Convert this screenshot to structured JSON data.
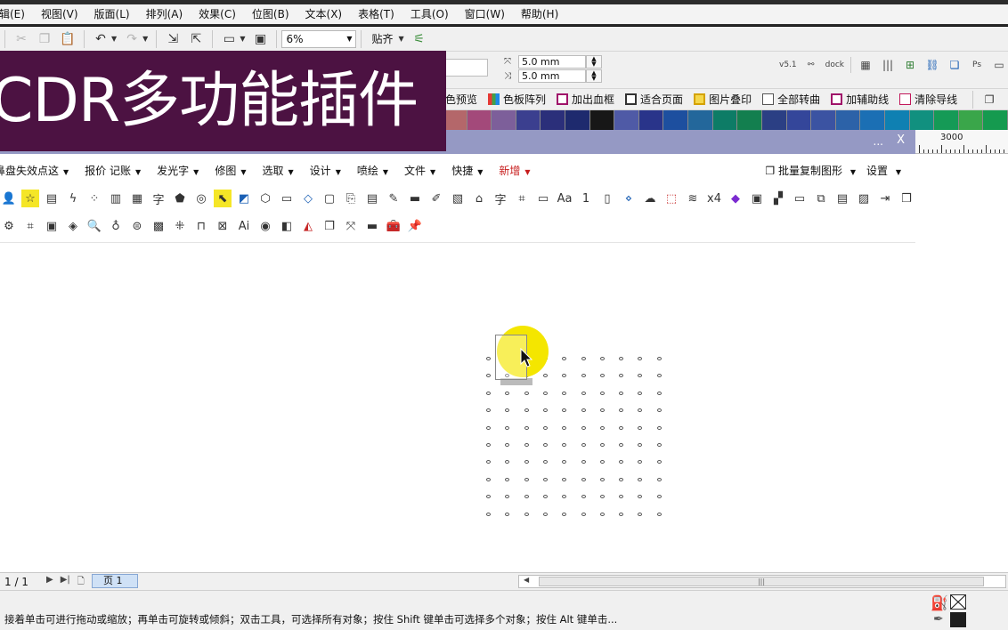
{
  "menubar": {
    "items": [
      "辑(E)",
      "视图(V)",
      "版面(L)",
      "排列(A)",
      "效果(C)",
      "位图(B)",
      "文本(X)",
      "表格(T)",
      "工具(O)",
      "窗口(W)",
      "帮助(H)"
    ]
  },
  "std_toolbar": {
    "zoom": "6%",
    "snap": "贴齐"
  },
  "property_bar": {
    "nudge_x": "5.0 mm",
    "nudge_y": "5.0 mm",
    "version_tag": "v5.1",
    "dock_label": "dock"
  },
  "plugin_toolbar": {
    "buttons": [
      "色预览",
      "色板阵列",
      "加出血框",
      "适合页面",
      "图片叠印",
      "全部转曲",
      "加辅助线",
      "清除导线"
    ]
  },
  "palette": {
    "colors": [
      "#e8262b",
      "#f04e23",
      "#ef6c1f",
      "#ea8a1d",
      "#d4492f",
      "#c72f57",
      "#d1417e",
      "#bf2f72",
      "#9c2b74",
      "#7a3c8d",
      "#68509c",
      "#9b8fc1",
      "#7fbf70",
      "#38a35b",
      "#1e9a60",
      "#1b8e57",
      "#97c66b",
      "#b6a56a",
      "#b4676a",
      "#a3497a",
      "#7d5f9a",
      "#3b3f8f",
      "#2b2f7a",
      "#1e2a6e",
      "#171717",
      "#4f5aa6",
      "#29348a",
      "#1d4f9f",
      "#23679b",
      "#0d7c66",
      "#137f4f",
      "#2b3f84",
      "#34469a",
      "#3b53a2",
      "#2c62a8",
      "#1b6fb4",
      "#0f80b2",
      "#11907f",
      "#159a56",
      "#3aa64a",
      "#159a4f"
    ]
  },
  "docker": {
    "dots": "...",
    "close": "X",
    "ruler_label": "3000"
  },
  "plugin_menu": {
    "items": [
      {
        "label": "鼻盘失效点这",
        "red": false
      },
      {
        "label": "报价 记账",
        "red": false
      },
      {
        "label": "发光字",
        "red": false
      },
      {
        "label": "修图",
        "red": false
      },
      {
        "label": "选取",
        "red": false
      },
      {
        "label": "设计",
        "red": false
      },
      {
        "label": "喷绘",
        "red": false
      },
      {
        "label": "文件",
        "red": false
      },
      {
        "label": "快捷",
        "red": false
      },
      {
        "label": "新增",
        "red": true
      }
    ],
    "batch_copy": "批量复制图形",
    "settings": "设置"
  },
  "plugin_icons": {
    "row1": [
      "add-user-icon",
      "star-icon",
      "pdf-icon",
      "lightning-icon",
      "grid-icon",
      "bars-icon",
      "frame-icon",
      "zi-icon",
      "pentagon-icon",
      "ring-icon",
      "cursor-select-icon",
      "quad-icon",
      "hexagon-icon",
      "capsule-icon",
      "diamond-icon",
      "rounded-icon",
      "stamp-icon",
      "id-card-icon",
      "edit-icon",
      "panel-icon",
      "pencil-icon",
      "image-icon",
      "lock-icon",
      "zi-box-icon",
      "crop-icon",
      "ruler-icon",
      "font-icon",
      "one-icon",
      "columns-icon",
      "nodes-icon",
      "cloud-icon",
      "dashed-box-icon",
      "layers-icon",
      "x4-icon",
      "bmp-icon",
      "jpg-icon",
      "qr-icon",
      "text-box-icon",
      "copy-icon",
      "align-icon",
      "paste-icon",
      "export-icon",
      "pages-icon"
    ],
    "row2": [
      "gear-icon",
      "crop-tool-icon",
      "image-small-icon",
      "shapes-icon",
      "doc-search-icon",
      "apple-icon",
      "equal-icon",
      "pattern-icon",
      "scatter-icon",
      "bridge-icon",
      "mesh-icon",
      "ai-icon",
      "circle-badge-icon",
      "blend-icon",
      "fill-bucket-icon",
      "duplicate-icon",
      "resize-icon",
      "black-bar-icon",
      "toolbox-icon",
      "pin-icon"
    ]
  },
  "canvas": {
    "grid_cols": 10,
    "grid_rows": 10
  },
  "pagebar": {
    "page_count": "1 / 1",
    "page_tab": "页 1"
  },
  "statusbar": {
    "text": "接着单击可进行拖动或缩放；再单击可旋转或倾斜；双击工具，可选择所有对象；按住 Shift 键单击可选择多个对象；按住 Alt 键单击..."
  },
  "banner": {
    "title": "CDR多功能插件"
  }
}
